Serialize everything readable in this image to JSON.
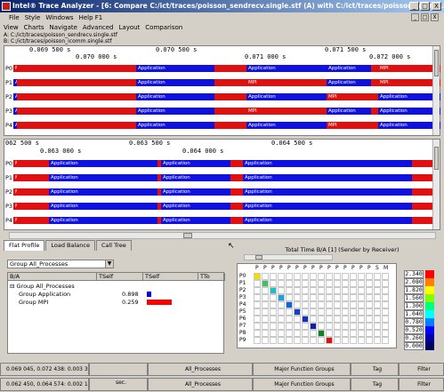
{
  "window": {
    "title": "Intel® Trace Analyzer - [6: Compare C:/ict/traces/poisson_sendrecv.single.stf (A) with C:/ict/traces/poisson_icomm.single.stf (B)]",
    "buttons": [
      "_",
      "□",
      "X"
    ]
  },
  "menu": {
    "file": "File",
    "style": "Style",
    "windows": "Windows",
    "help": "Help F1"
  },
  "submenu": {
    "view": "View",
    "charts": "Charts",
    "navigate": "Navigate",
    "advanced": "Advanced",
    "layout": "Layout",
    "comparison": "Comparison"
  },
  "mdi_buttons": [
    "_",
    "□",
    "X"
  ],
  "files": {
    "a": "A: C:/ict/traces/poisson_sendrecv.single.stf",
    "b": "B: C:/ict/traces/poisson_icomm.single.stf"
  },
  "timeline_a": {
    "ticks_top": [
      "0.069 500 s",
      "0.070 500 s",
      "0.071 500 s"
    ],
    "ticks_bottom": [
      "0.070 000 s",
      "0.071 000 s",
      "0.072 000 s"
    ],
    "rows": [
      {
        "label": "P0",
        "segs": [
          {
            "t": "MPI"
          },
          {
            "t": "Application"
          },
          {
            "t": "Application"
          },
          {
            "t": "Application"
          },
          {
            "t": "MPI"
          }
        ]
      },
      {
        "label": "P1",
        "segs": [
          {
            "t": "Application"
          },
          {
            "t": "Application"
          },
          {
            "t": "MPI"
          },
          {
            "t": "Application"
          },
          {
            "t": "MPI"
          }
        ]
      },
      {
        "label": "P2",
        "segs": [
          {
            "t": "Application"
          },
          {
            "t": "Application"
          },
          {
            "t": "Application"
          },
          {
            "t": "MPI"
          },
          {
            "t": "Application"
          }
        ]
      },
      {
        "label": "P3",
        "segs": [
          {
            "t": "Application"
          },
          {
            "t": "Application"
          },
          {
            "t": "MPI"
          },
          {
            "t": "Application"
          },
          {
            "t": "Application"
          }
        ]
      },
      {
        "label": "P4",
        "segs": [
          {
            "t": "Application"
          },
          {
            "t": "Application"
          },
          {
            "t": "Application"
          },
          {
            "t": "MPI"
          },
          {
            "t": "Application"
          }
        ]
      }
    ]
  },
  "timeline_b": {
    "ticks_top": [
      "062 500 s",
      "0.063 500 s",
      "0.064 500 s"
    ],
    "ticks_bottom": [
      "0.063 000 s",
      "0.064 000 s"
    ],
    "rows": [
      {
        "label": "P0",
        "segs": [
          {
            "t": "MPI"
          },
          {
            "t": "Application"
          },
          {
            "t": "Application"
          },
          {
            "t": "Application"
          }
        ]
      },
      {
        "label": "P1",
        "segs": [
          {
            "t": "MPI"
          },
          {
            "t": "Application"
          },
          {
            "t": "Application"
          },
          {
            "t": "Application"
          }
        ]
      },
      {
        "label": "P2",
        "segs": [
          {
            "t": "MPI"
          },
          {
            "t": "Application"
          },
          {
            "t": "Application"
          },
          {
            "t": "Application"
          }
        ]
      },
      {
        "label": "P3",
        "segs": [
          {
            "t": "MPI"
          },
          {
            "t": "Application"
          },
          {
            "t": "Application"
          },
          {
            "t": "Application"
          }
        ]
      },
      {
        "label": "P4",
        "segs": [
          {
            "t": "MPI"
          },
          {
            "t": "Application"
          },
          {
            "t": "Application"
          },
          {
            "t": "Application"
          }
        ]
      }
    ]
  },
  "tabs": [
    "Flat Profile",
    "Load Balance",
    "Call Tree"
  ],
  "group_dropdown": "Group All_Processes",
  "profile": {
    "headers": [
      "B/A",
      "TSelf",
      "TSelf",
      "TTo"
    ],
    "rows": [
      {
        "name": "⊟ Group All_Processes",
        "value": "",
        "bar": 0
      },
      {
        "name": "Group Application",
        "value": "0.898",
        "bar": 0.18
      },
      {
        "name": "Group MPI",
        "value": "0.259",
        "bar": 1.0
      }
    ]
  },
  "matrix": {
    "title": "Total Time B/A [1] (Sender by Receiver)",
    "headers": [
      "P",
      "P",
      "P",
      "P",
      "P",
      "P",
      "P",
      "P",
      "P",
      "P",
      "P",
      "P",
      "P",
      "P",
      "P",
      "S",
      "M"
    ],
    "row_labels": [
      "P0",
      "P1",
      "P2",
      "P3",
      "P4",
      "P5",
      "P6",
      "P7",
      "P8",
      "P9"
    ],
    "diag_colors": [
      "#f0e000",
      "#40c060",
      "#20c0c0",
      "#20a0e0",
      "#1060e0",
      "#1040d0",
      "#1030c0",
      "#1020b0",
      "#108020",
      "#e01010"
    ]
  },
  "legend": [
    {
      "value": "2.340",
      "color": "#ff0000"
    },
    {
      "value": "2.080",
      "color": "#ff8000"
    },
    {
      "value": "1.820",
      "color": "#ffff00"
    },
    {
      "value": "1.560",
      "color": "#80ff00"
    },
    {
      "value": "1.300",
      "color": "#00ff80"
    },
    {
      "value": "1.040",
      "color": "#00ffff"
    },
    {
      "value": "0.780",
      "color": "#0080ff"
    },
    {
      "value": "0.520",
      "color": "#0000ff"
    },
    {
      "value": "0.260",
      "color": "#0000a0"
    },
    {
      "value": "0.000",
      "color": "#000060"
    }
  ],
  "status": [
    {
      "range": "0.069 045, 0.072 438: 0.003 393",
      "processes": "All_Processes",
      "groups": "Major Function Groups",
      "tag": "Tag",
      "filter": "Filter"
    },
    {
      "range": "0.062 450, 0.064 574: 0.002 124",
      "processes": "All_Processes",
      "groups": "Major Function Groups",
      "tag": "Tag",
      "filter": "Filter"
    }
  ],
  "status_unit": "sec."
}
